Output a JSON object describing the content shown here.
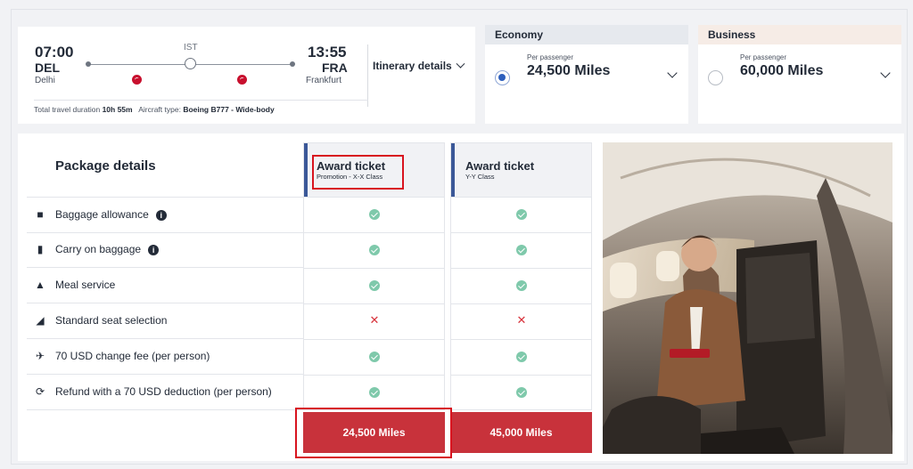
{
  "flight": {
    "departure_time": "07:00",
    "departure_code": "DEL",
    "departure_city": "Delhi",
    "arrival_time": "13:55",
    "arrival_code": "FRA",
    "arrival_city": "Frankfurt",
    "stop_code": "IST",
    "itinerary_label": "Itinerary details",
    "duration_label": "Total travel duration",
    "duration_value": "10h 55m",
    "aircraft_label": "Aircraft type:",
    "aircraft_value": "Boeing B777 - Wide-body"
  },
  "fares": [
    {
      "cabin": "Economy",
      "per_label": "Per passenger",
      "miles": "24,500 Miles",
      "selected": true,
      "header_color": "#e6e9ee"
    },
    {
      "cabin": "Business",
      "per_label": "Per passenger",
      "miles": "60,000 Miles",
      "selected": false,
      "header_color": "#f6ece6"
    }
  ],
  "package": {
    "title": "Package details",
    "features": [
      {
        "label": "Baggage allowance",
        "icon": "baggage-icon",
        "info": true
      },
      {
        "label": "Carry on baggage",
        "icon": "carry-on-icon",
        "info": true
      },
      {
        "label": "Meal service",
        "icon": "meal-icon",
        "info": false
      },
      {
        "label": "Standard seat selection",
        "icon": "seat-icon",
        "info": false
      },
      {
        "label": "70 USD change fee (per person)",
        "icon": "change-fee-icon",
        "info": false
      },
      {
        "label": "Refund with a 70 USD deduction (per person)",
        "icon": "refund-icon",
        "info": false
      }
    ],
    "columns": [
      {
        "name": "Award ticket",
        "class": "Promotion - X-X Class",
        "price": "24,500 Miles",
        "included": [
          true,
          true,
          true,
          false,
          true,
          true
        ]
      },
      {
        "name": "Award ticket",
        "class": "Y-Y Class",
        "price": "45,000 Miles",
        "included": [
          true,
          true,
          true,
          false,
          true,
          true
        ]
      }
    ]
  },
  "colors": {
    "accent_red": "#c8323b",
    "highlight_red": "#d8141f",
    "check_green": "#7fc9ab",
    "column_bar": "#3b5898"
  }
}
